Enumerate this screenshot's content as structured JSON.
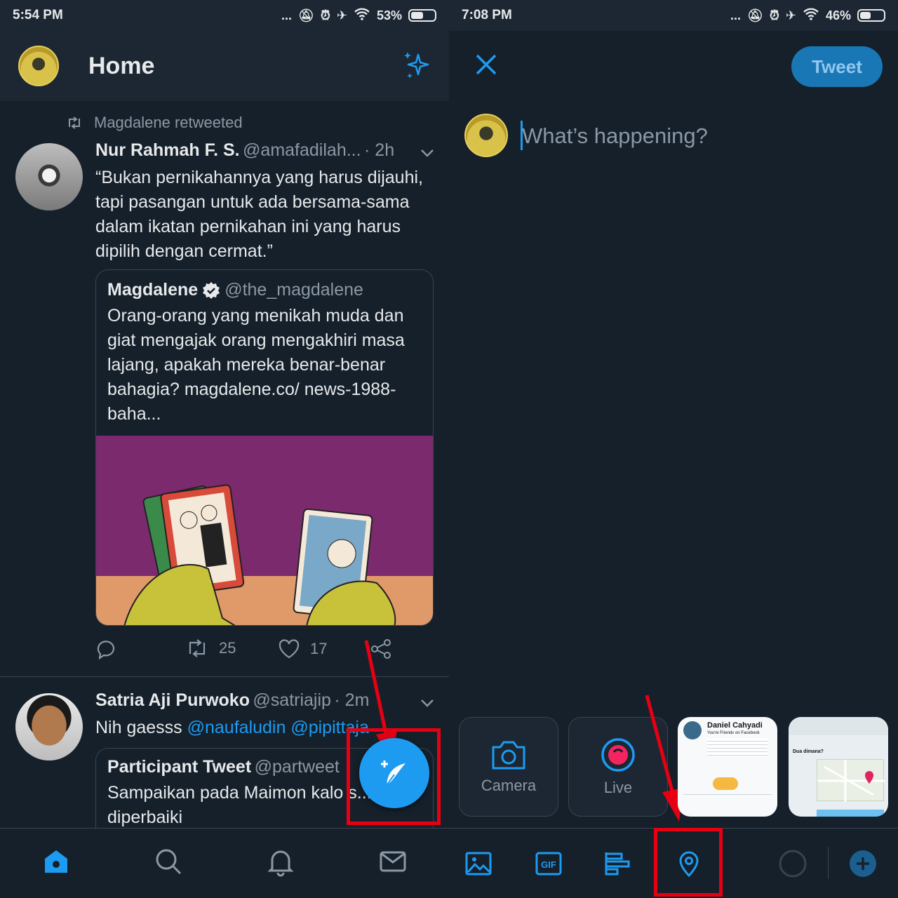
{
  "left": {
    "status": {
      "time": "5:54 PM",
      "dots": "...",
      "battery": "53%",
      "battery_level": 0.53
    },
    "header": {
      "title": "Home"
    },
    "tweet1": {
      "retweeted_by": "Magdalene retweeted",
      "name": "Nur Rahmah F. S.",
      "handle": "@amafadilah...",
      "time": "· 2h",
      "text": "“Bukan pernikahannya yang harus dijauhi, tapi pasangan untuk ada bersama-sama dalam ikatan pernikahan ini yang harus dipilih dengan cermat.”",
      "quote": {
        "name": "Magdalene",
        "handle": "@the_magdalene",
        "text": "Orang-orang yang menikah muda dan giat mengajak orang mengakhiri masa lajang, apakah mereka benar-benar bahagia? magdalene.co/ news-1988-baha..."
      },
      "retweets": "25",
      "likes": "17"
    },
    "tweet2": {
      "name": "Satria Aji Purwoko",
      "handle": "@satriajip",
      "time": "· 2m",
      "text_prefix": "Nih gaesss ",
      "mentions": "@naufaludin @pipittaja",
      "quote": {
        "name": "Participant Tweet",
        "handle": "@partweet",
        "text": "Sampaikan pada Maimon kalo s... diperbaiki"
      }
    }
  },
  "right": {
    "status": {
      "time": "7:08 PM",
      "dots": "...",
      "battery": "46%",
      "battery_level": 0.46
    },
    "header": {
      "tweet_button": "Tweet"
    },
    "compose": {
      "placeholder": "What’s happening?"
    },
    "media_tiles": {
      "camera": "Camera",
      "live": "Live"
    },
    "thumb1": {
      "title": "Daniel Cahyadi",
      "subtitle": "You're Friends on Facebook"
    },
    "thumb2": {
      "title": "Dua dimana?"
    }
  },
  "colors": {
    "accent": "#1d9bf0",
    "background": "#15202b",
    "annotation": "#e60012"
  }
}
